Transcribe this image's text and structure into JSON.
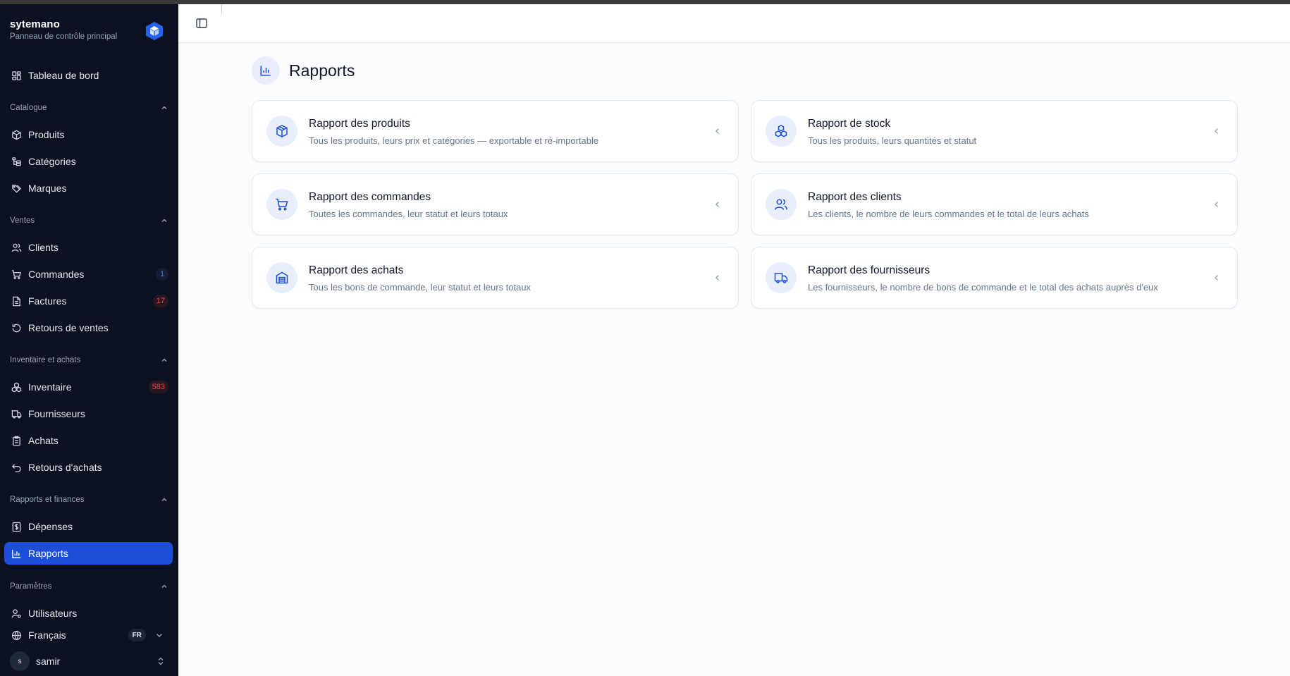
{
  "app": {
    "name": "sytemano",
    "subtitle": "Panneau de contrôle principal"
  },
  "sidebar": {
    "dashboard": "Tableau de bord",
    "groups": {
      "catalogue": "Catalogue",
      "ventes": "Ventes",
      "inventaire": "Inventaire et achats",
      "rapports": "Rapports et finances",
      "parametres": "Paramètres"
    },
    "items": {
      "produits": "Produits",
      "categories": "Catégories",
      "marques": "Marques",
      "clients": "Clients",
      "commandes": "Commandes",
      "factures": "Factures",
      "retours_ventes": "Retours de ventes",
      "inventaire": "Inventaire",
      "fournisseurs": "Fournisseurs",
      "achats": "Achats",
      "retours_achats": "Retours d'achats",
      "depenses": "Dépenses",
      "rapports": "Rapports",
      "utilisateurs": "Utilisateurs"
    },
    "badges": {
      "commandes": "1",
      "factures": "17",
      "inventaire": "583"
    },
    "language": {
      "label": "Français",
      "code": "FR"
    },
    "user": {
      "initial": "s",
      "name": "samir"
    }
  },
  "main": {
    "page_title": "Rapports",
    "cards": [
      {
        "title": "Rapport des produits",
        "desc": "Tous les produits, leurs prix et catégories — exportable et ré-importable",
        "icon": "package-icon"
      },
      {
        "title": "Rapport de stock",
        "desc": "Tous les produits, leurs quantités et statut",
        "icon": "boxes-icon"
      },
      {
        "title": "Rapport des commandes",
        "desc": "Toutes les commandes, leur statut et leurs totaux",
        "icon": "cart-icon"
      },
      {
        "title": "Rapport des clients",
        "desc": "Les clients, le nombre de leurs commandes et le total de leurs achats",
        "icon": "users-icon"
      },
      {
        "title": "Rapport des achats",
        "desc": "Tous les bons de commande, leur statut et leurs totaux",
        "icon": "warehouse-icon"
      },
      {
        "title": "Rapport des fournisseurs",
        "desc": "Les fournisseurs, le nombre de bons de commande et le total des achats auprès d'eux",
        "icon": "truck-icon"
      }
    ]
  },
  "colors": {
    "sidebar_bg": "#0b1120",
    "accent": "#1d4ed8",
    "badge_blue": "#3b82f6",
    "badge_red": "#ef4444"
  }
}
